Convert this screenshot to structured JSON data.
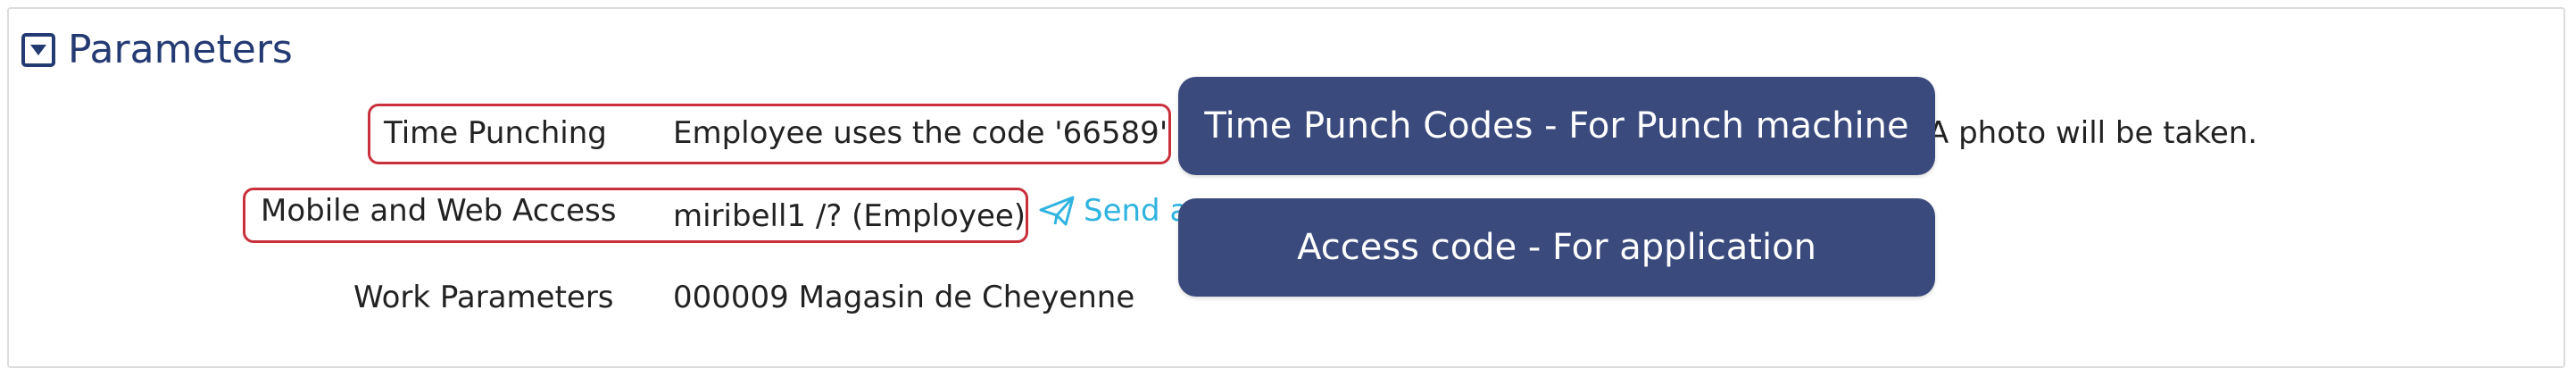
{
  "section": {
    "title": "Parameters"
  },
  "rows": [
    {
      "label": "Time Punching",
      "value": "Employee uses the code '66589'",
      "value_suffix": "A photo will be taken."
    },
    {
      "label": "Mobile and Web Access",
      "value": "miribell1 /? (Employee)",
      "action": "Send a"
    },
    {
      "label": "Work Parameters",
      "value": "000009 Magasin de Cheyenne"
    }
  ],
  "annotations": [
    {
      "text": "Time Punch Codes - For Punch machine"
    },
    {
      "text": "Access code - For application"
    }
  ],
  "colors": {
    "title": "#243a73",
    "highlight": "#c9303c",
    "tooltip_bg": "#3a4a7c",
    "link": "#2fb3e0"
  },
  "icons": {
    "toggle": "caret-down-square-icon",
    "send": "paper-plane-icon"
  }
}
